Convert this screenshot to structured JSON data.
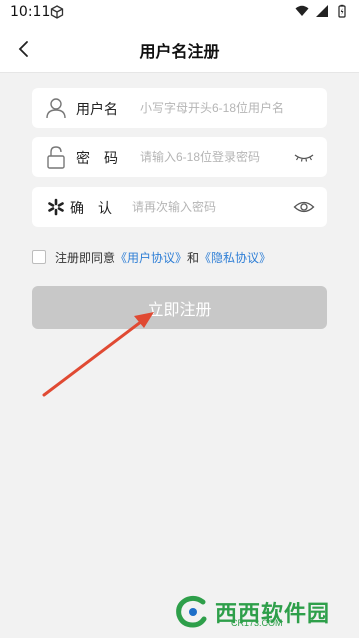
{
  "status_bar": {
    "time": "10:11",
    "icons": [
      "cube-icon",
      "wifi-icon",
      "signal-icon",
      "battery-icon"
    ]
  },
  "header": {
    "title": "用户名注册",
    "back_icon": "back-arrow-icon"
  },
  "form": {
    "username": {
      "label": "用户名",
      "placeholder": "小写字母开头6-18位用户名",
      "value": "",
      "icon": "user-icon"
    },
    "password": {
      "label": "密　码",
      "placeholder": "请输入6-18位登录密码",
      "value": "",
      "icon": "lock-icon",
      "toggle_icon": "eye-closed-icon"
    },
    "confirm": {
      "label": "确　认",
      "placeholder": "请再次输入密码",
      "value": "",
      "icon": "asterisk-icon",
      "toggle_icon": "eye-open-icon"
    }
  },
  "agreement": {
    "checked": false,
    "prefix": "注册即同意",
    "user_agreement": "《用户协议》",
    "conjunction": "和",
    "privacy_policy": "《隐私协议》",
    "link_color": "#2f7fd6"
  },
  "register_button": {
    "label": "立即注册",
    "enabled": false,
    "color": "#c8c8c8"
  },
  "annotation": {
    "arrow_color": "#e04a33"
  },
  "watermark": {
    "text": "西西软件园",
    "sub": "CR173.COM"
  }
}
